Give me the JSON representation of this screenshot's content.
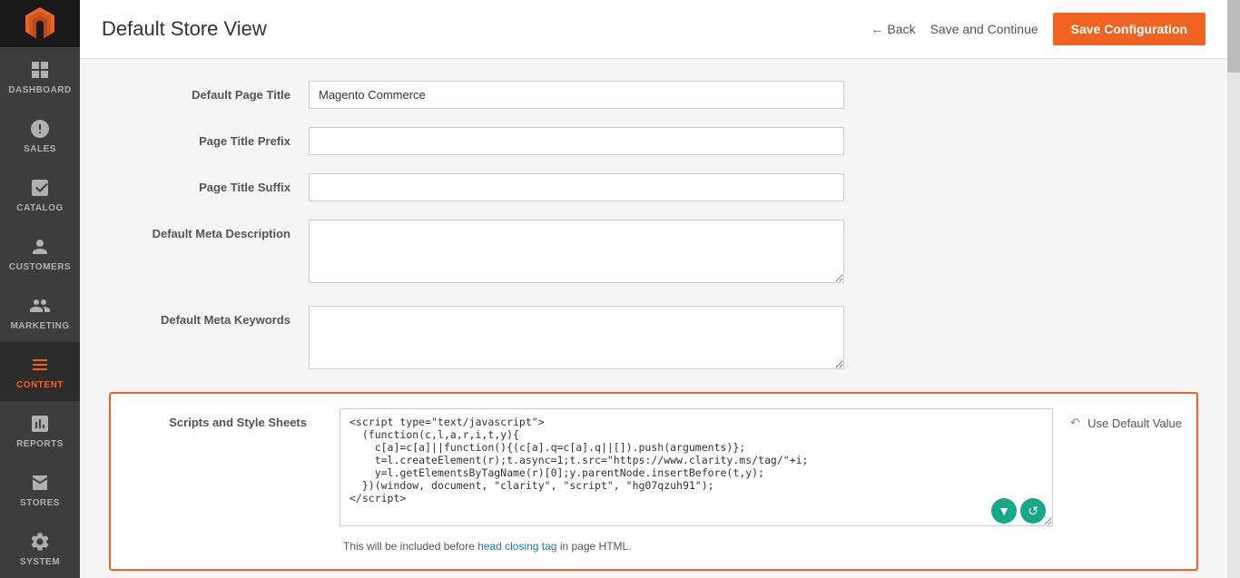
{
  "sidebar": {
    "logo_alt": "Magento Logo",
    "items": [
      {
        "id": "dashboard",
        "label": "DASHBOARD",
        "icon": "dashboard-icon"
      },
      {
        "id": "sales",
        "label": "SALES",
        "icon": "sales-icon"
      },
      {
        "id": "catalog",
        "label": "CATALOG",
        "icon": "catalog-icon"
      },
      {
        "id": "customers",
        "label": "CUSTOMERS",
        "icon": "customers-icon"
      },
      {
        "id": "marketing",
        "label": "MARKETING",
        "icon": "marketing-icon"
      },
      {
        "id": "content",
        "label": "CONTENT",
        "icon": "content-icon",
        "active": true
      },
      {
        "id": "reports",
        "label": "REPORTS",
        "icon": "reports-icon"
      },
      {
        "id": "stores",
        "label": "STORES",
        "icon": "stores-icon"
      },
      {
        "id": "system",
        "label": "SYSTEM",
        "icon": "system-icon"
      }
    ]
  },
  "header": {
    "title": "Default Store View",
    "back_label": "Back",
    "save_continue_label": "Save and Continue",
    "save_config_label": "Save Configuration"
  },
  "form": {
    "fields": [
      {
        "label": "Default Page Title",
        "value": "Magento Commerce",
        "type": "input"
      },
      {
        "label": "Page Title Prefix",
        "value": "",
        "type": "input"
      },
      {
        "label": "Page Title Suffix",
        "value": "",
        "type": "input"
      },
      {
        "label": "Default Meta Description",
        "value": "",
        "type": "textarea"
      },
      {
        "label": "Default Meta Keywords",
        "value": "",
        "type": "textarea"
      }
    ],
    "scripts_label": "Scripts and Style Sheets",
    "scripts_value": "<script type=\"text/javascript\">\n  (function(c,l,a,r,i,t,y){\n    c[a]=c[a]||function(){(c[a].q=c[a].q||[]).push(arguments)};\n    t=l.createElement(r);t.async=1;t.src=\"https://www.clarity.ms/tag/\"+i;\n    y=l.getElementsByTagName(r)[0];y.parentNode.insertBefore(t,y);\n  })(window, document, \"clarity\", \"script\", \"hg07qzuh91\");\n<\\/script>",
    "scripts_note_before": "This will be included before ",
    "scripts_note_link": "head closing tag",
    "scripts_note_after": " in page HTML.",
    "use_default_label": "Use Default Value"
  }
}
